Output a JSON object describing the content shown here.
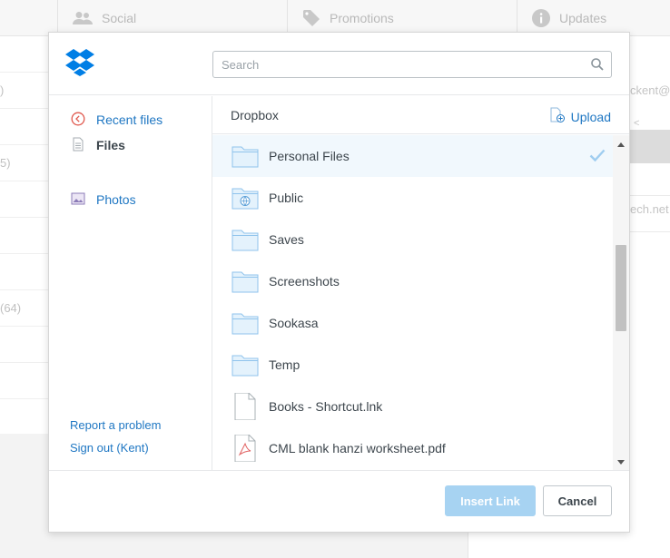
{
  "background": {
    "tabs": [
      {
        "label": "Social",
        "icon": "people-icon"
      },
      {
        "label": "Promotions",
        "icon": "tag-icon"
      },
      {
        "label": "Updates",
        "icon": "info-icon"
      }
    ],
    "row_fragments": [
      ")",
      "5)",
      "(64)"
    ],
    "right_fragments": [
      "ckent@k",
      "<",
      "ech.net"
    ]
  },
  "dialog": {
    "search": {
      "placeholder": "Search",
      "value": ""
    },
    "sidebar": {
      "items": [
        {
          "label": "Recent files",
          "icon": "clock-icon",
          "active": false
        },
        {
          "label": "Files",
          "icon": "document-icon",
          "active": true
        },
        {
          "label": "Photos",
          "icon": "photo-icon",
          "active": false
        }
      ],
      "report_link": "Report a problem",
      "signout_link": "Sign out (Kent)"
    },
    "breadcrumb": "Dropbox",
    "upload_label": "Upload",
    "files": [
      {
        "name": "Personal Files",
        "type": "folder",
        "selected": true
      },
      {
        "name": "Public",
        "type": "public-folder",
        "selected": false
      },
      {
        "name": "Saves",
        "type": "folder",
        "selected": false
      },
      {
        "name": "Screenshots",
        "type": "folder",
        "selected": false
      },
      {
        "name": "Sookasa",
        "type": "folder",
        "selected": false
      },
      {
        "name": "Temp",
        "type": "folder",
        "selected": false
      },
      {
        "name": "Books - Shortcut.lnk",
        "type": "file",
        "selected": false
      },
      {
        "name": "CML blank hanzi worksheet.pdf",
        "type": "pdf",
        "selected": false
      }
    ],
    "buttons": {
      "insert_label": "Insert Link",
      "cancel_label": "Cancel"
    },
    "colors": {
      "accent": "#1f77c3",
      "insert_disabled": "#a7d3f2",
      "folder": "#9fcff5"
    }
  }
}
